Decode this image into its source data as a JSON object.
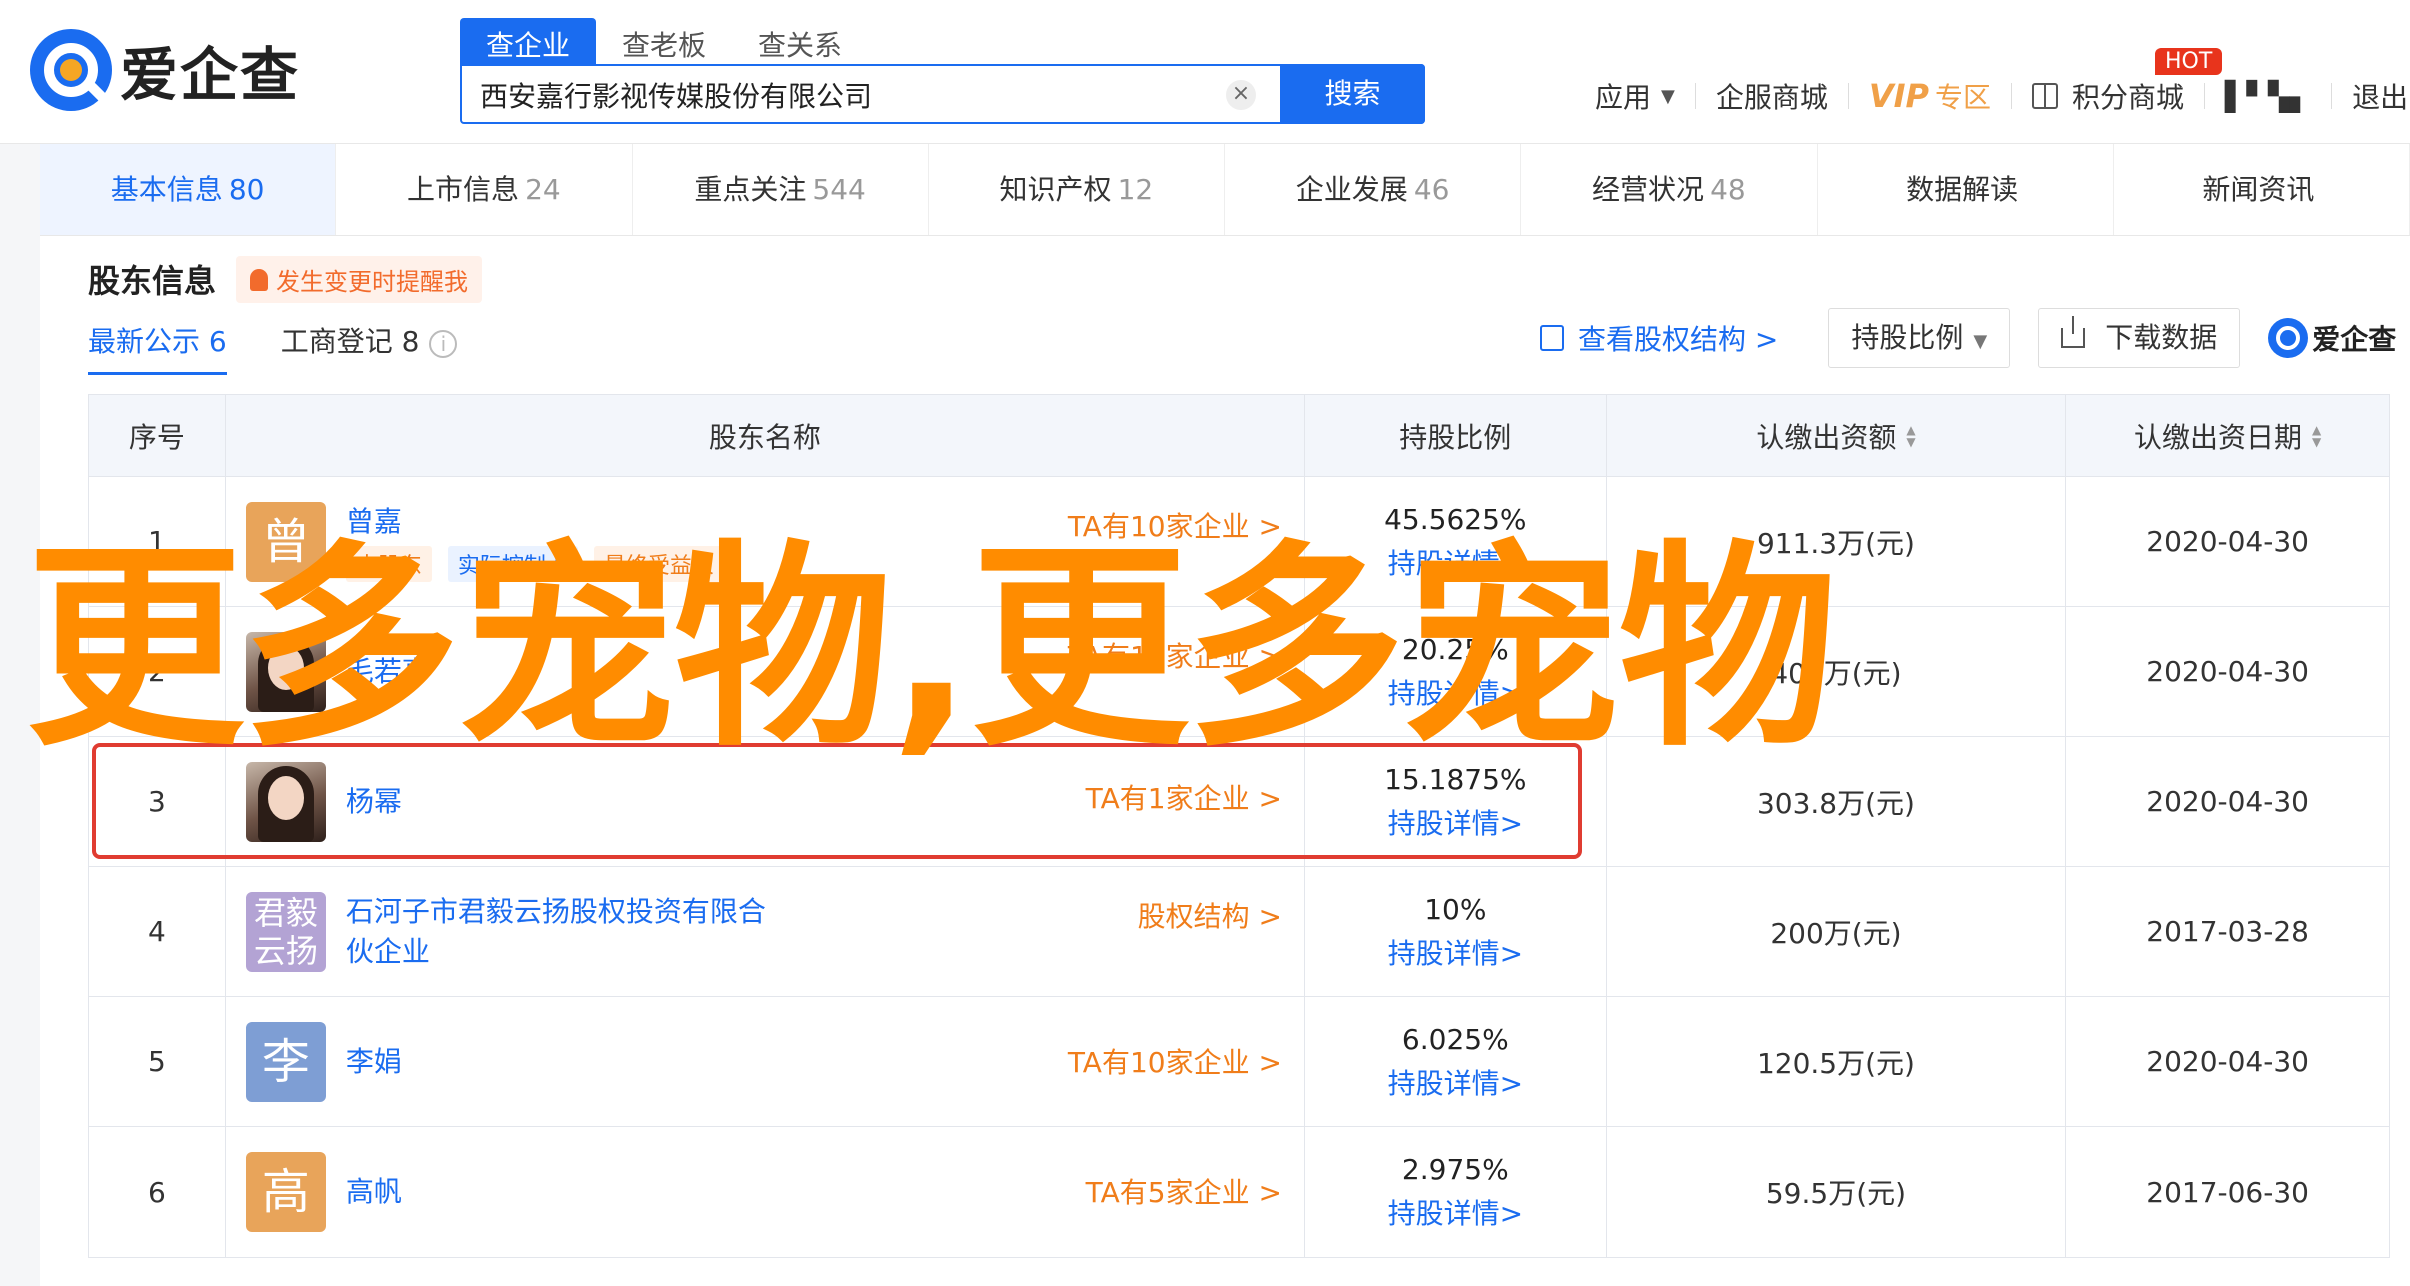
{
  "logo": {
    "text": "爱企查",
    "mini_text": "爱企查"
  },
  "search": {
    "tabs": [
      "查企业",
      "查老板",
      "查关系"
    ],
    "value": "西安嘉行影视传媒股份有限公司",
    "clear": "×",
    "button": "搜索"
  },
  "topnav": {
    "app": "应用",
    "app_caret": "▼",
    "mall": "企服商城",
    "vip": "VIP",
    "vip_sub": "专区",
    "points": "积分商城",
    "hot": "HOT",
    "user": "▌▘▚▖",
    "logout": "退出"
  },
  "categories": [
    {
      "label": "基本信息",
      "count": "80"
    },
    {
      "label": "上市信息",
      "count": "24"
    },
    {
      "label": "重点关注",
      "count": "544"
    },
    {
      "label": "知识产权",
      "count": "12"
    },
    {
      "label": "企业发展",
      "count": "46"
    },
    {
      "label": "经营状况",
      "count": "48"
    },
    {
      "label": "数据解读",
      "count": ""
    },
    {
      "label": "新闻资讯",
      "count": ""
    }
  ],
  "section": {
    "title": "股东信息",
    "alert": "发生变更时提醒我",
    "subtabs": [
      "最新公示 6",
      "工商登记 8"
    ],
    "info": "i",
    "view_structure": "查看股权结构 >",
    "ratio_dropdown": "持股比例",
    "download": "下载数据"
  },
  "table": {
    "headers": {
      "idx": "序号",
      "name": "股东名称",
      "ratio": "持股比例",
      "amount": "认缴出资额",
      "date": "认缴出资日期"
    },
    "rows": [
      {
        "idx": "1",
        "avatar": "曾",
        "avatar_color": "#e8a45a",
        "name": "曾嘉",
        "tags": [
          "大股东",
          "实际控制人",
          "最终受益人"
        ],
        "link": "TA有10家企业 >",
        "ratio": "45.5625%",
        "detail": "持股详情>",
        "amount": "911.3万(元)",
        "date": "2020-04-30"
      },
      {
        "idx": "2",
        "avatar": "",
        "avatar_color": "",
        "name": "毛若亭",
        "tags": [],
        "link": "TA有11家企业 >",
        "ratio": "20.25%",
        "detail": "持股详情>",
        "amount": "405万(元)",
        "date": "2020-04-30"
      },
      {
        "idx": "3",
        "avatar": "",
        "avatar_color": "",
        "name": "杨幂",
        "tags": [],
        "link": "TA有1家企业 >",
        "ratio": "15.1875%",
        "detail": "持股详情>",
        "amount": "303.8万(元)",
        "date": "2020-04-30"
      },
      {
        "idx": "4",
        "avatar": "君毅云扬",
        "avatar_color": "#b3a3d4",
        "name": "石河子市君毅云扬股权投资有限合伙企业",
        "name_line1": "石河子市君毅云扬股权投资有限合",
        "name_line2": "伙企业",
        "tags": [],
        "link": "股权结构 >",
        "ratio": "10%",
        "detail": "持股详情>",
        "amount": "200万(元)",
        "date": "2017-03-28"
      },
      {
        "idx": "5",
        "avatar": "李",
        "avatar_color": "#7e9ed4",
        "name": "李娟",
        "tags": [],
        "link": "TA有10家企业 >",
        "ratio": "6.025%",
        "detail": "持股详情>",
        "amount": "120.5万(元)",
        "date": "2020-04-30"
      },
      {
        "idx": "6",
        "avatar": "高",
        "avatar_color": "#e8a45a",
        "name": "高帆",
        "tags": [],
        "link": "TA有5家企业 >",
        "ratio": "2.975%",
        "detail": "持股详情>",
        "amount": "59.5万(元)",
        "date": "2017-06-30"
      }
    ]
  },
  "watermark": "更多宠物,更多宠物",
  "colors": {
    "brand": "#1a6cf0",
    "orange": "#f07d1a",
    "highlight": "#e03c31",
    "watermark": "#ff8c00"
  }
}
